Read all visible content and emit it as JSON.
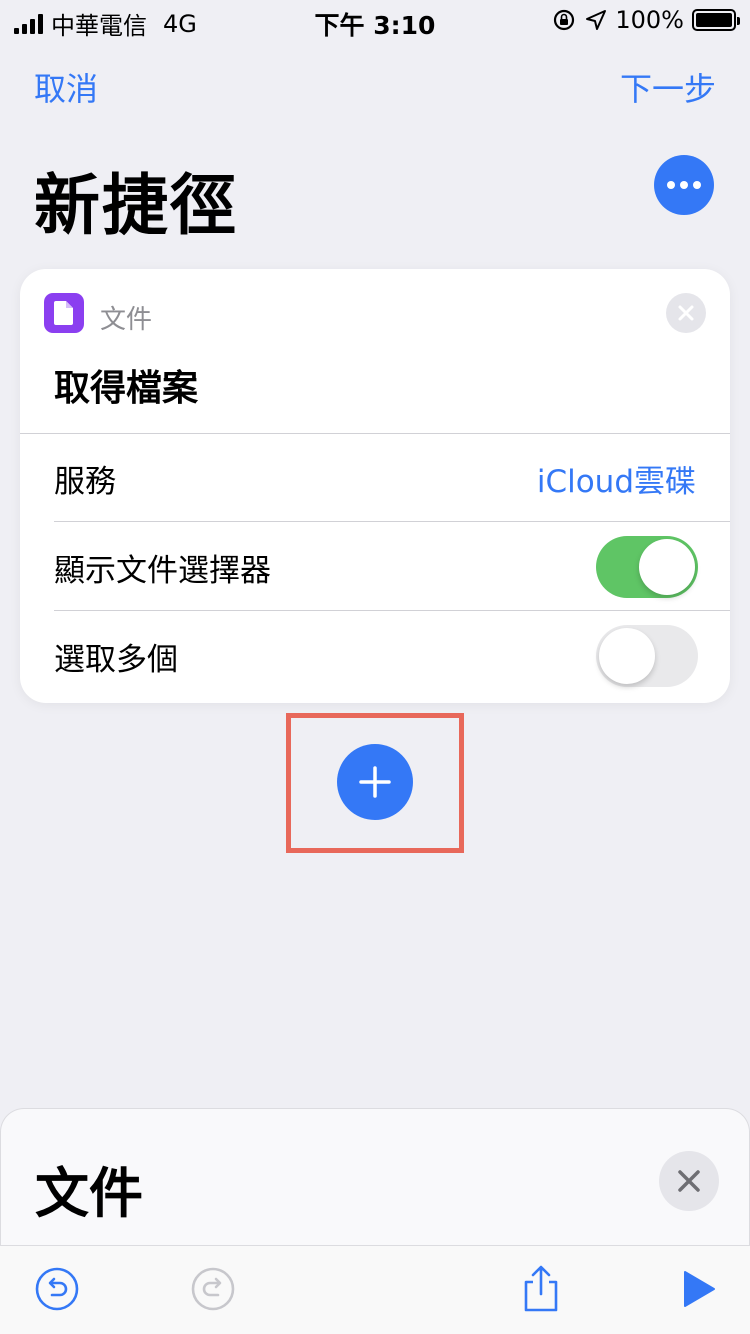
{
  "status_bar": {
    "carrier": "中華電信",
    "network": "4G",
    "time": "下午 3:10",
    "battery": "100%"
  },
  "nav": {
    "cancel_label": "取消",
    "next_label": "下一步"
  },
  "page": {
    "title": "新捷徑"
  },
  "action_card": {
    "app_name": "文件",
    "action_title": "取得檔案",
    "rows": [
      {
        "label": "服務",
        "value": "iCloud雲碟"
      },
      {
        "label": "顯示文件選擇器",
        "toggle": "on"
      },
      {
        "label": "選取多個",
        "toggle": "off"
      }
    ]
  },
  "sheet": {
    "title": "文件"
  },
  "colors": {
    "accent": "#3478f6",
    "toggle_on": "#5fc565",
    "highlight": "#e8685a",
    "files_app": "#8b3ff0"
  },
  "icons": {
    "card_app": "document-icon",
    "more": "ellipsis-icon",
    "add": "plus-icon",
    "undo": "undo-icon",
    "redo": "redo-icon",
    "share": "share-icon",
    "run": "play-icon"
  }
}
